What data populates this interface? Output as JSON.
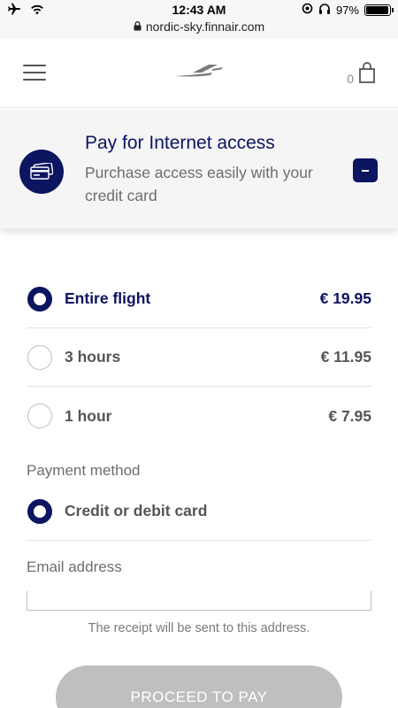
{
  "status_bar": {
    "time": "12:43 AM",
    "battery_percent": "97%",
    "battery_level": 0.97
  },
  "browser": {
    "url": "nordic-sky.finnair.com"
  },
  "header": {
    "cart_count": "0"
  },
  "info_card": {
    "title": "Pay for Internet access",
    "subtitle": "Purchase access easily with your credit card",
    "collapse_symbol": "−"
  },
  "plans": [
    {
      "label": "Entire flight",
      "price": "€ 19.95",
      "selected": true
    },
    {
      "label": "3 hours",
      "price": "€ 11.95",
      "selected": false
    },
    {
      "label": "1 hour",
      "price": "€ 7.95",
      "selected": false
    }
  ],
  "payment": {
    "section_label": "Payment method",
    "method_label": "Credit or debit card"
  },
  "email": {
    "label": "Email address",
    "value": "",
    "receipt_note": "The receipt will be sent to this address."
  },
  "proceed_button": {
    "label": "PROCEED TO PAY"
  },
  "colors": {
    "brand": "#0b1560",
    "button_disabled": "#bfbfbf"
  },
  "icons": [
    "airplane-icon",
    "wifi-icon",
    "lock-icon",
    "alarm-icon",
    "headphones-icon",
    "battery-icon",
    "hamburger-icon",
    "finnair-logo",
    "shopping-bag-icon",
    "credit-card-icon"
  ]
}
